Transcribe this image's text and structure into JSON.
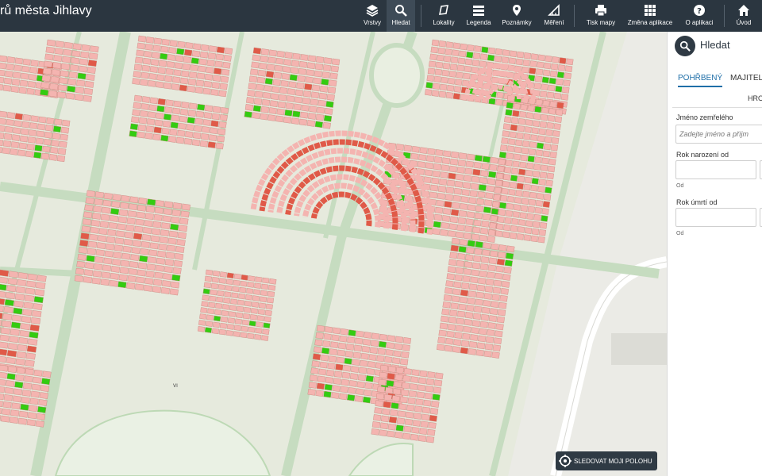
{
  "app": {
    "title": "rů města Jihlavy"
  },
  "toolbar": {
    "layers": "Vrstvy",
    "search": "Hledat",
    "localities": "Lokality",
    "legend": "Legenda",
    "notes": "Poznámky",
    "measure": "Měření",
    "print": "Tisk mapy",
    "change_app": "Změna aplikace",
    "about": "O aplikaci",
    "home": "Úvod"
  },
  "panel": {
    "title": "Hledat",
    "tabs": {
      "buried": "POHŘBENÝ",
      "owner": "MAJITEL"
    },
    "sub_tab": "HROBOVÉ",
    "fields": {
      "name_label": "Jméno zemřelého",
      "name_placeholder": "Zadejte jméno a příjm",
      "birth_year_label": "Rok narození od",
      "birth_from_hint": "Od",
      "death_year_label": "Rok úmrtí od",
      "death_from_hint": "Od"
    }
  },
  "map": {
    "follow_button": "SLEDOVAT MOJI POLOHU",
    "section_label": "VI"
  },
  "colors": {
    "toolbar_bg": "#2b3640",
    "grave_free": "#f4b4b0",
    "grave_green": "#33cc11",
    "grave_red": "#e05a48",
    "path": "#c9ddc2",
    "accent": "#1f6fa8"
  }
}
